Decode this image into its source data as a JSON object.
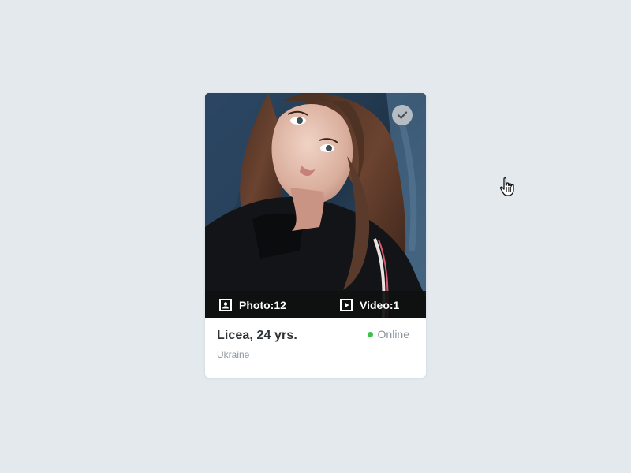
{
  "profile_card": {
    "name": "Licea, 24 yrs.",
    "country": "Ukraine",
    "status": "Online",
    "photo_count_label": "Photo:12",
    "video_count_label": "Video:1"
  },
  "icons": {
    "verified": "verified-check-icon",
    "photos": "portrait-icon",
    "videos": "play-icon",
    "cursor": "hand-pointer-icon"
  },
  "colors": {
    "page_background": "#e3e9ed",
    "card_background": "#ffffff",
    "media_bar": "#0f1110",
    "online_dot": "#3ac34b",
    "status_text": "#8a959e",
    "name_text": "#2e3338",
    "country_text": "#8e979f"
  }
}
